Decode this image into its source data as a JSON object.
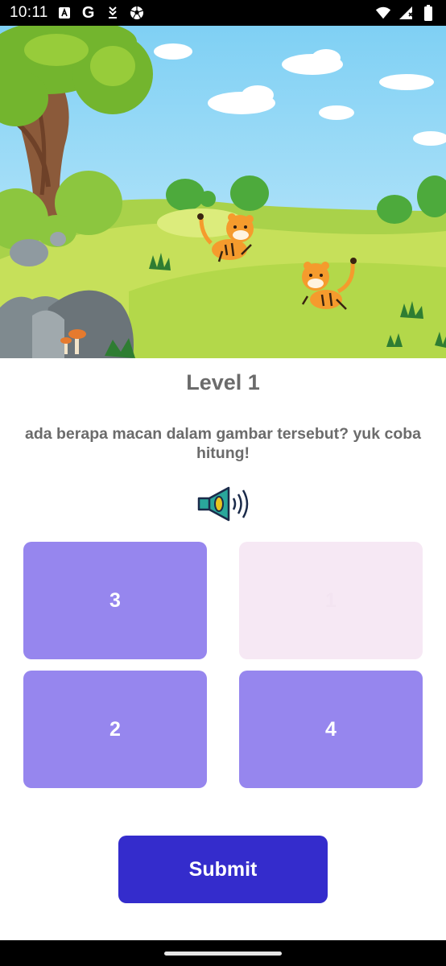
{
  "status_bar": {
    "time": "10:11",
    "left_icons": [
      "a-box-icon",
      "google-g-icon",
      "download-icon",
      "soccer-ball-icon"
    ],
    "google_letter": "G",
    "right_icons": [
      "wifi-icon",
      "signal-icon",
      "battery-icon"
    ]
  },
  "game": {
    "level_title": "Level 1",
    "question": "ada berapa macan dalam gambar tersebut? yuk coba hitung!",
    "speaker_icon": "speaker-sound-icon",
    "options": [
      {
        "label": "3"
      },
      {
        "label": "1"
      },
      {
        "label": "2"
      },
      {
        "label": "4"
      }
    ],
    "submit_label": "Submit"
  },
  "colors": {
    "option_purple": "#9686ee",
    "option_selected_pale": "#f6e8f4",
    "submit": "#342ccc",
    "title_grey": "#6b6b6b"
  }
}
